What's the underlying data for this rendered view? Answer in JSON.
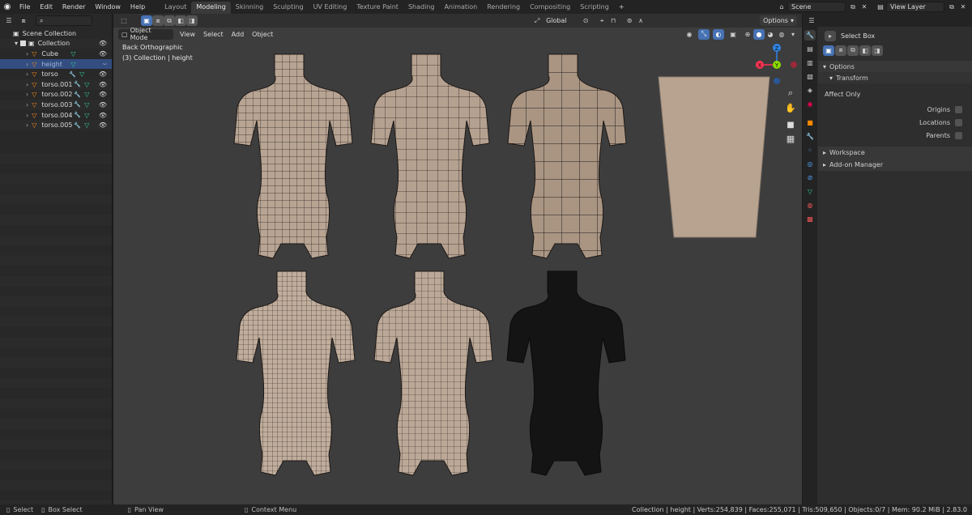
{
  "topbar": {
    "menus": [
      "File",
      "Edit",
      "Render",
      "Window",
      "Help"
    ],
    "workspaces": [
      "Layout",
      "Modeling",
      "Skinning",
      "Sculpting",
      "UV Editing",
      "Texture Paint",
      "Shading",
      "Animation",
      "Rendering",
      "Compositing",
      "Scripting"
    ],
    "active_workspace": "Modeling",
    "add_tab_label": "+",
    "scene": "Scene",
    "view_layer": "View Layer"
  },
  "outliner": {
    "root": "Scene Collection",
    "collection": "Collection",
    "items": [
      {
        "label": "Cube",
        "selected": false
      },
      {
        "label": "height",
        "selected": true
      },
      {
        "label": "torso",
        "selected": false
      },
      {
        "label": "torso.001",
        "selected": false
      },
      {
        "label": "torso.002",
        "selected": false
      },
      {
        "label": "torso.003",
        "selected": false
      },
      {
        "label": "torso.004",
        "selected": false
      },
      {
        "label": "torso.005",
        "selected": false
      }
    ]
  },
  "viewport": {
    "orientation": "Global",
    "options_label": "Options",
    "mode": "Object Mode",
    "menus": [
      "View",
      "Select",
      "Add",
      "Object"
    ],
    "view_name": "Back Orthographic",
    "view_subtitle": "(3) Collection | height",
    "gizmo": {
      "x": "X",
      "y": "Y",
      "z": "Z"
    },
    "colors": {
      "bg": "#3d3d3d",
      "skin": "#b6a291",
      "dark": "#151515",
      "plane": "#b7a390"
    }
  },
  "properties": {
    "tool": "Select Box",
    "options_header": "Options",
    "transform_header": "Transform",
    "affect_only": "Affect Only",
    "checkboxes": [
      "Origins",
      "Locations",
      "Parents"
    ],
    "workspace_header": "Workspace",
    "addon_header": "Add-on Manager"
  },
  "statusbar": {
    "select": "Select",
    "box_select": "Box Select",
    "pan_view": "Pan View",
    "context_menu": "Context Menu",
    "stats": "Collection | height | Verts:254,839 | Faces:255,071 | Tris:509,650 | Objects:0/7 | Mem: 90.2 MiB | 2.83.0"
  }
}
